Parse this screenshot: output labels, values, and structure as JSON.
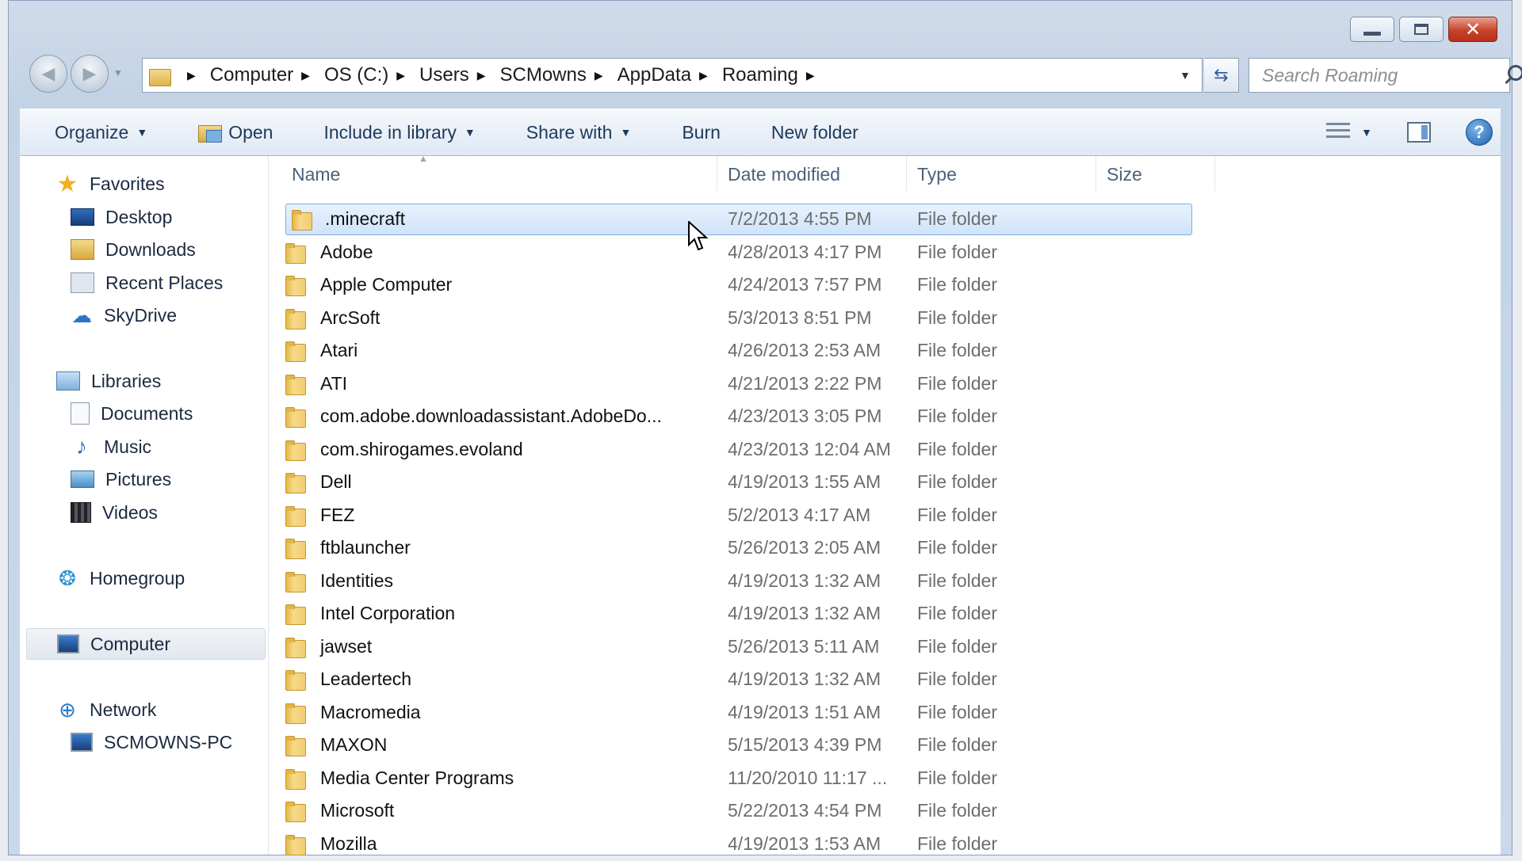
{
  "window": {
    "controls": {
      "minimize": "minimize",
      "maximize": "maximize",
      "close": "close"
    }
  },
  "nav": {
    "back_icon": "back-arrow-icon",
    "forward_icon": "forward-arrow-icon",
    "breadcrumbs": [
      "Computer",
      "OS (C:)",
      "Users",
      "SCMowns",
      "AppData",
      "Roaming"
    ],
    "search_placeholder": "Search Roaming"
  },
  "toolbar": {
    "organize": "Organize",
    "open": "Open",
    "include_in_library": "Include in library",
    "share_with": "Share with",
    "burn": "Burn",
    "new_folder": "New folder"
  },
  "sidebar": {
    "favorites": {
      "label": "Favorites",
      "items": [
        "Desktop",
        "Downloads",
        "Recent Places",
        "SkyDrive"
      ]
    },
    "libraries": {
      "label": "Libraries",
      "items": [
        "Documents",
        "Music",
        "Pictures",
        "Videos"
      ]
    },
    "homegroup": "Homegroup",
    "computer": "Computer",
    "network": {
      "label": "Network",
      "items": [
        "SCMOWNS-PC"
      ]
    }
  },
  "columns": {
    "name": "Name",
    "date": "Date modified",
    "type": "Type",
    "size": "Size"
  },
  "files": [
    {
      "name": ".minecraft",
      "date": "7/2/2013 4:55 PM",
      "type": "File folder",
      "selected": true
    },
    {
      "name": "Adobe",
      "date": "4/28/2013 4:17 PM",
      "type": "File folder"
    },
    {
      "name": "Apple Computer",
      "date": "4/24/2013 7:57 PM",
      "type": "File folder"
    },
    {
      "name": "ArcSoft",
      "date": "5/3/2013 8:51 PM",
      "type": "File folder"
    },
    {
      "name": "Atari",
      "date": "4/26/2013 2:53 AM",
      "type": "File folder"
    },
    {
      "name": "ATI",
      "date": "4/21/2013 2:22 PM",
      "type": "File folder"
    },
    {
      "name": "com.adobe.downloadassistant.AdobeDo...",
      "date": "4/23/2013 3:05 PM",
      "type": "File folder"
    },
    {
      "name": "com.shirogames.evoland",
      "date": "4/23/2013 12:04 AM",
      "type": "File folder"
    },
    {
      "name": "Dell",
      "date": "4/19/2013 1:55 AM",
      "type": "File folder"
    },
    {
      "name": "FEZ",
      "date": "5/2/2013 4:17 AM",
      "type": "File folder"
    },
    {
      "name": "ftblauncher",
      "date": "5/26/2013 2:05 AM",
      "type": "File folder"
    },
    {
      "name": "Identities",
      "date": "4/19/2013 1:32 AM",
      "type": "File folder"
    },
    {
      "name": "Intel Corporation",
      "date": "4/19/2013 1:32 AM",
      "type": "File folder"
    },
    {
      "name": "jawset",
      "date": "5/26/2013 5:11 AM",
      "type": "File folder"
    },
    {
      "name": "Leadertech",
      "date": "4/19/2013 1:32 AM",
      "type": "File folder"
    },
    {
      "name": "Macromedia",
      "date": "4/19/2013 1:51 AM",
      "type": "File folder"
    },
    {
      "name": "MAXON",
      "date": "5/15/2013 4:39 PM",
      "type": "File folder"
    },
    {
      "name": "Media Center Programs",
      "date": "11/20/2010 11:17 ...",
      "type": "File folder"
    },
    {
      "name": "Microsoft",
      "date": "5/22/2013 4:54 PM",
      "type": "File folder"
    },
    {
      "name": "Mozilla",
      "date": "4/19/2013 1:53 AM",
      "type": "File folder"
    }
  ]
}
